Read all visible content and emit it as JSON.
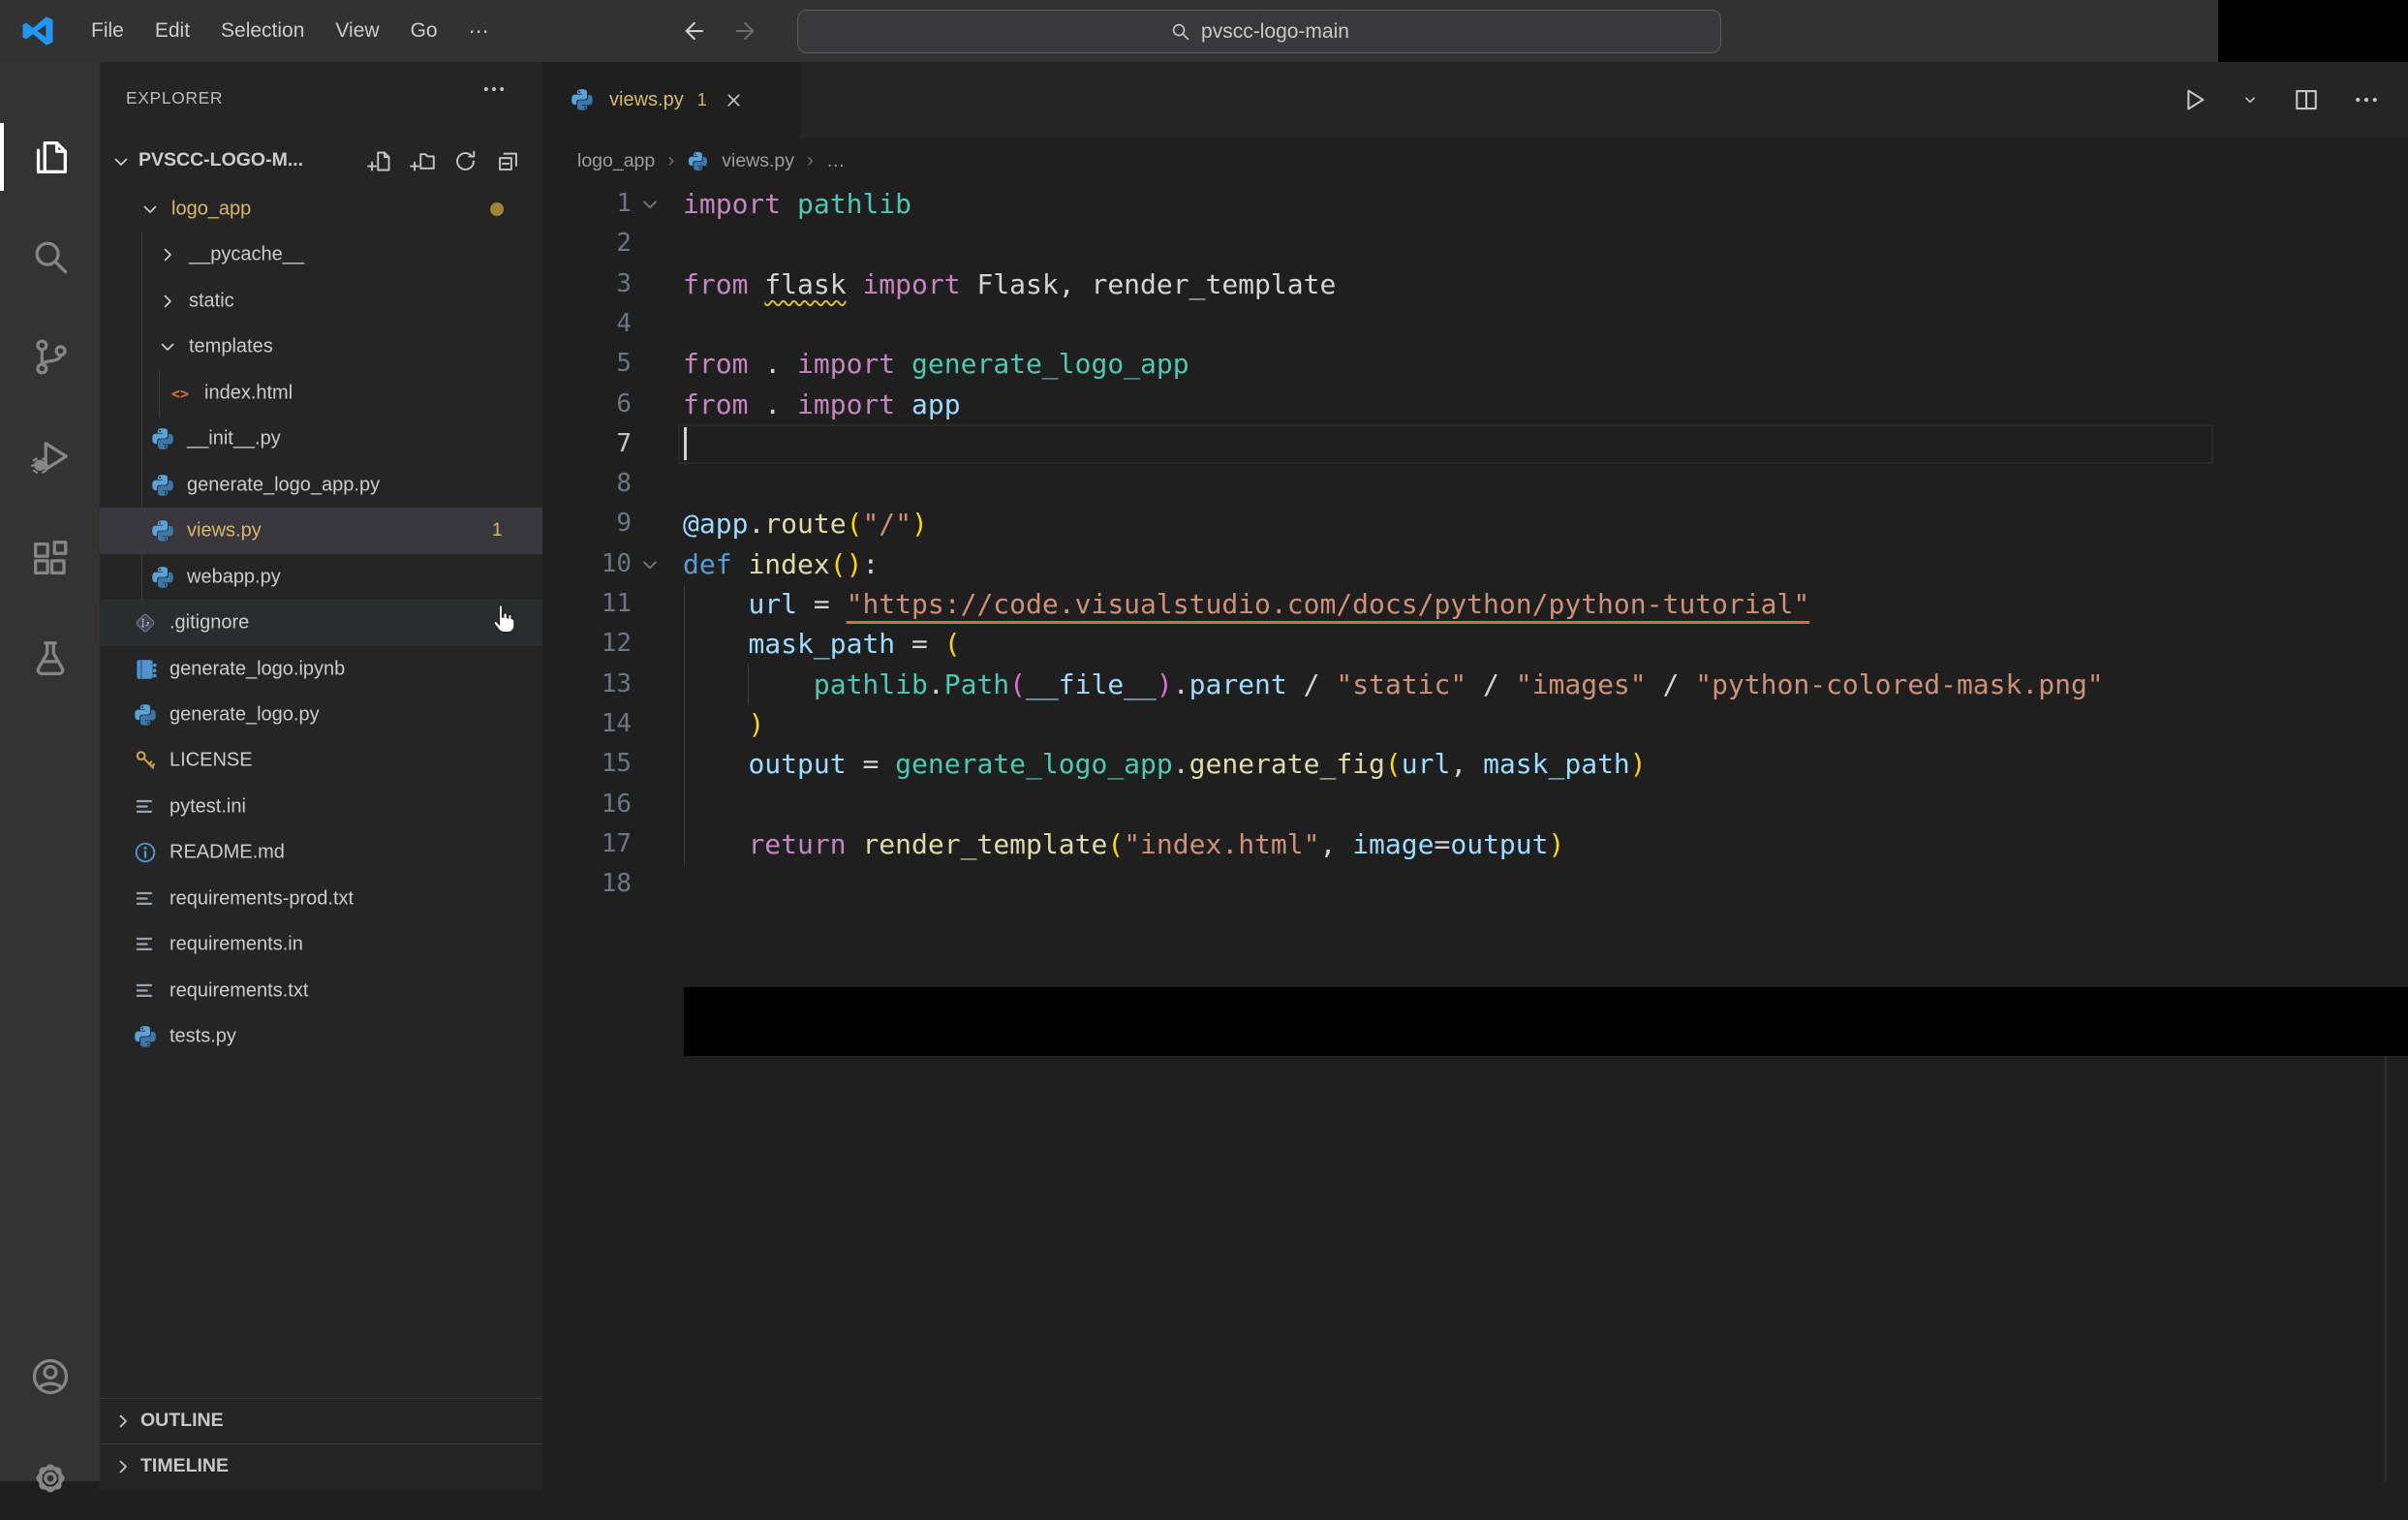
{
  "colors": {
    "titlebar": "#323233",
    "activity": "#333333",
    "sidebar": "#252526",
    "editor": "#1f1f1f",
    "tabstrip": "#252526",
    "rowSelected": "#37373d",
    "rowHover": "#2a2d2e",
    "modified": "#d9b768",
    "dot": "#9c8636",
    "kw": "#c586c0",
    "ty": "#4ec9b0",
    "vr": "#9cdcfe",
    "fn": "#dcdcaa",
    "df": "#569cd6",
    "st": "#ce9178",
    "pl": "#d4d4d4",
    "b1": "#ffd700",
    "b2": "#da70d6",
    "lineNum": "#6e7681",
    "lineNumActive": "#c6c6c6",
    "squiggle": "#d7ba3d",
    "urlUnderline": "#c4714f",
    "accentBlue": "#2196f3"
  },
  "title_bar": {
    "menus": [
      "File",
      "Edit",
      "Selection",
      "View",
      "Go",
      "⋯"
    ],
    "search": {
      "value": "pvscc-logo-main"
    }
  },
  "activity_bar": {
    "items": [
      {
        "name": "explorer",
        "active": true
      },
      {
        "name": "search",
        "active": false
      },
      {
        "name": "source-control",
        "active": false
      },
      {
        "name": "run-and-debug",
        "active": false
      },
      {
        "name": "extensions",
        "active": false
      },
      {
        "name": "testing",
        "active": false
      },
      {
        "name": "accounts",
        "active": false
      },
      {
        "name": "manage",
        "active": false
      }
    ]
  },
  "explorer": {
    "title": "EXPLORER",
    "section": "PVSCC-LOGO-M...",
    "actions": [
      "new-file",
      "new-folder",
      "refresh-explorer",
      "collapse-folders"
    ],
    "tree": [
      {
        "label": "logo_app",
        "kind": "folder",
        "expanded": true,
        "level": 0,
        "modified": true,
        "dot": true
      },
      {
        "label": "__pycache__",
        "kind": "folder",
        "expanded": false,
        "level": 1
      },
      {
        "label": "static",
        "kind": "folder",
        "expanded": false,
        "level": 1
      },
      {
        "label": "templates",
        "kind": "folder",
        "expanded": true,
        "level": 1
      },
      {
        "label": "index.html",
        "kind": "file",
        "icon": "html",
        "level": 2
      },
      {
        "label": "__init__.py",
        "kind": "file",
        "icon": "py",
        "level": 1
      },
      {
        "label": "generate_logo_app.py",
        "kind": "file",
        "icon": "py",
        "level": 1
      },
      {
        "label": "views.py",
        "kind": "file",
        "icon": "py",
        "level": 1,
        "selected": true,
        "modified": true,
        "badge": "1"
      },
      {
        "label": "webapp.py",
        "kind": "file",
        "icon": "py",
        "level": 1
      },
      {
        "label": ".gitignore",
        "kind": "file",
        "icon": "git",
        "level": 0,
        "hovered": true
      },
      {
        "label": "generate_logo.ipynb",
        "kind": "file",
        "icon": "nb",
        "level": 0
      },
      {
        "label": "generate_logo.py",
        "kind": "file",
        "icon": "py",
        "level": 0
      },
      {
        "label": "LICENSE",
        "kind": "file",
        "icon": "key",
        "level": 0
      },
      {
        "label": "pytest.ini",
        "kind": "file",
        "icon": "cfg",
        "level": 0
      },
      {
        "label": "README.md",
        "kind": "file",
        "icon": "info",
        "level": 0
      },
      {
        "label": "requirements-prod.txt",
        "kind": "file",
        "icon": "cfg",
        "level": 0
      },
      {
        "label": "requirements.in",
        "kind": "file",
        "icon": "cfg",
        "level": 0
      },
      {
        "label": "requirements.txt",
        "kind": "file",
        "icon": "cfg",
        "level": 0
      },
      {
        "label": "tests.py",
        "kind": "file",
        "icon": "py",
        "level": 0
      }
    ],
    "bottom_sections": [
      "OUTLINE",
      "TIMELINE"
    ]
  },
  "editor": {
    "tab": {
      "label": "views.py",
      "badge": "1",
      "icon": "py"
    },
    "actions": [
      "run",
      "run-dropdown",
      "split-editor",
      "more-actions"
    ],
    "breadcrumb": [
      {
        "label": "logo_app"
      },
      {
        "label": "views.py",
        "icon": "py"
      },
      {
        "label": "…"
      }
    ],
    "code": {
      "active_line": 7,
      "lines": [
        {
          "n": 1,
          "fold": true,
          "tokens": [
            [
              "kw",
              "import"
            ],
            [
              "pl",
              " "
            ],
            [
              "ty",
              "pathlib"
            ]
          ]
        },
        {
          "n": 2,
          "tokens": []
        },
        {
          "n": 3,
          "tokens": [
            [
              "kw",
              "from"
            ],
            [
              "pl",
              " "
            ],
            [
              "sq",
              "flask"
            ],
            [
              "pl",
              " "
            ],
            [
              "kw",
              "import"
            ],
            [
              "pl",
              " Flask, render_template"
            ]
          ]
        },
        {
          "n": 4,
          "tokens": []
        },
        {
          "n": 5,
          "tokens": [
            [
              "kw",
              "from"
            ],
            [
              "pl",
              " . "
            ],
            [
              "kw",
              "import"
            ],
            [
              "pl",
              " "
            ],
            [
              "ty",
              "generate_logo_app"
            ]
          ]
        },
        {
          "n": 6,
          "tokens": [
            [
              "kw",
              "from"
            ],
            [
              "pl",
              " . "
            ],
            [
              "kw",
              "import"
            ],
            [
              "pl",
              " "
            ],
            [
              "vr",
              "app"
            ]
          ]
        },
        {
          "n": 7,
          "tokens": []
        },
        {
          "n": 8,
          "tokens": []
        },
        {
          "n": 9,
          "tokens": [
            [
              "vr",
              "@app"
            ],
            [
              "pl",
              "."
            ],
            [
              "fn",
              "route"
            ],
            [
              "b1",
              "("
            ],
            [
              "st",
              "\"/\""
            ],
            [
              "b1",
              ")"
            ]
          ]
        },
        {
          "n": 10,
          "fold": true,
          "tokens": [
            [
              "df",
              "def"
            ],
            [
              "pl",
              " "
            ],
            [
              "fn",
              "index"
            ],
            [
              "b1",
              "()"
            ],
            [
              "pl",
              ":"
            ]
          ]
        },
        {
          "n": 11,
          "tokens": [
            [
              "pl",
              "    "
            ],
            [
              "vr",
              "url"
            ],
            [
              "pl",
              " = "
            ],
            [
              "stU",
              "\"https://code.visualstudio.com/docs/python/python-tutorial\""
            ]
          ]
        },
        {
          "n": 12,
          "tokens": [
            [
              "pl",
              "    "
            ],
            [
              "vr",
              "mask_path"
            ],
            [
              "pl",
              " = "
            ],
            [
              "b1",
              "("
            ]
          ]
        },
        {
          "n": 13,
          "tokens": [
            [
              "pl",
              "        "
            ],
            [
              "ty",
              "pathlib"
            ],
            [
              "pl",
              "."
            ],
            [
              "ty",
              "Path"
            ],
            [
              "b2",
              "("
            ],
            [
              "vr",
              "__file__"
            ],
            [
              "b2",
              ")"
            ],
            [
              "pl",
              "."
            ],
            [
              "vr",
              "parent"
            ],
            [
              "pl",
              " / "
            ],
            [
              "st",
              "\"static\""
            ],
            [
              "pl",
              " / "
            ],
            [
              "st",
              "\"images\""
            ],
            [
              "pl",
              " / "
            ],
            [
              "st",
              "\"python-colored-mask.png\""
            ]
          ]
        },
        {
          "n": 14,
          "tokens": [
            [
              "pl",
              "    "
            ],
            [
              "b1",
              ")"
            ]
          ]
        },
        {
          "n": 15,
          "tokens": [
            [
              "pl",
              "    "
            ],
            [
              "vr",
              "output"
            ],
            [
              "pl",
              " = "
            ],
            [
              "ty",
              "generate_logo_app"
            ],
            [
              "pl",
              "."
            ],
            [
              "fn",
              "generate_fig"
            ],
            [
              "b1",
              "("
            ],
            [
              "vr",
              "url"
            ],
            [
              "pl",
              ", "
            ],
            [
              "vr",
              "mask_path"
            ],
            [
              "b1",
              ")"
            ]
          ]
        },
        {
          "n": 16,
          "tokens": []
        },
        {
          "n": 17,
          "tokens": [
            [
              "pl",
              "    "
            ],
            [
              "kw",
              "return"
            ],
            [
              "pl",
              " "
            ],
            [
              "fn",
              "render_template"
            ],
            [
              "b1",
              "("
            ],
            [
              "st",
              "\"index.html\""
            ],
            [
              "pl",
              ", "
            ],
            [
              "vr",
              "image"
            ],
            [
              "pl",
              "="
            ],
            [
              "vr",
              "output"
            ],
            [
              "b1",
              ")"
            ]
          ]
        },
        {
          "n": 18,
          "tokens": []
        }
      ]
    }
  }
}
